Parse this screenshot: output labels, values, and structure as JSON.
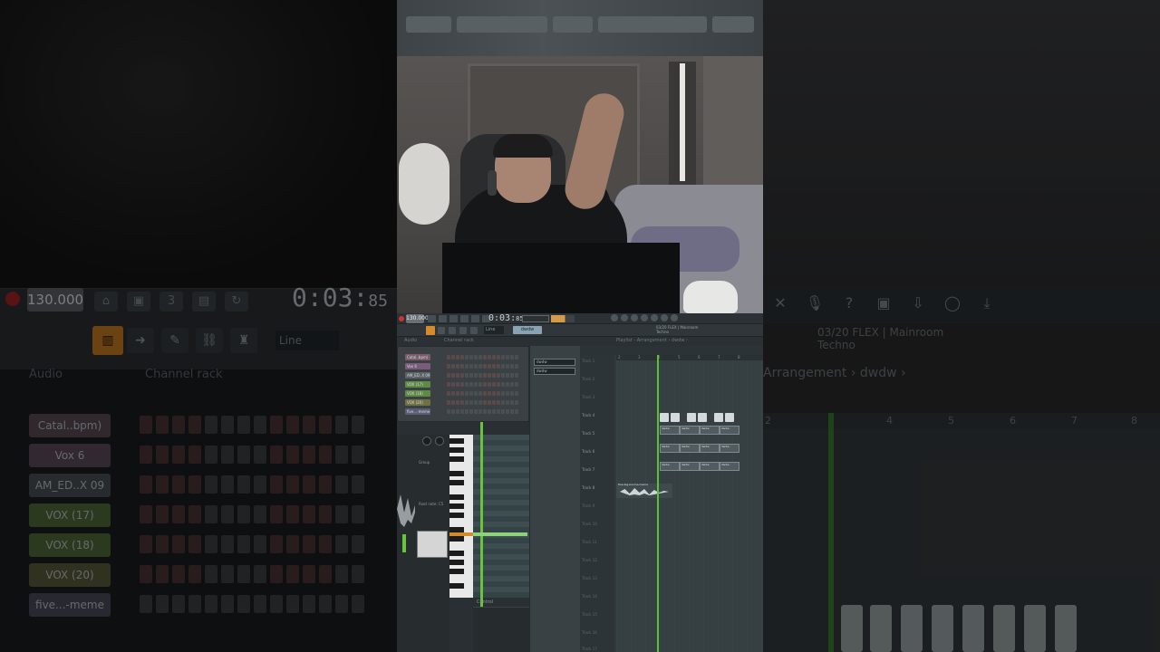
{
  "left_bg": {
    "bpm": "130.000",
    "time_main": "0:03",
    "time_frac": "85",
    "menu_audio": "Audio",
    "menu_channel_rack": "Channel rack",
    "snap": "Line",
    "channels": [
      {
        "name": "Catal..bpm)",
        "color": "#5a4a52"
      },
      {
        "name": "Vox 6",
        "color": "#5a4a5a"
      },
      {
        "name": "AM_ED..X 09",
        "color": "#4a4f52"
      },
      {
        "name": "VOX (17)",
        "color": "#4f6a3a"
      },
      {
        "name": "VOX (18)",
        "color": "#4f6a3a"
      },
      {
        "name": "VOX (20)",
        "color": "#5a5a3a"
      },
      {
        "name": "five...-meme",
        "color": "#4a4a5a"
      }
    ]
  },
  "right_bg": {
    "news_line1": "03/20  FLEX | Mainroom",
    "news_line2": "Techno",
    "breadcrumb": "Arrangement › dwdw ›",
    "ruler": [
      "2",
      "4",
      "5",
      "6",
      "7",
      "8"
    ]
  },
  "fl": {
    "bpm": "130.000",
    "time_main": "0:03",
    "time_frac": "85",
    "snap": "Line",
    "pattern": "dwdw",
    "news": [
      "03/20 FLEX | Mainroom",
      "Techno"
    ],
    "row2": {
      "audio": "Audio",
      "channel_rack": "Channel rack",
      "playlist": "Playlist - Arrangement › dwdw ›"
    },
    "channels": [
      {
        "name": "Catal..bpm)",
        "color": "#7a5c6a"
      },
      {
        "name": "Vox 6",
        "color": "#7a5c7a"
      },
      {
        "name": "AM_ED..X 09",
        "color": "#5c6266"
      },
      {
        "name": "VOX (17)",
        "color": "#5e8a44"
      },
      {
        "name": "VOX (18)",
        "color": "#5e8a44"
      },
      {
        "name": "VOX (20)",
        "color": "#707044"
      },
      {
        "name": "five...-meme",
        "color": "#5c5c74"
      }
    ],
    "piano_labels": {
      "group": "Group",
      "root_note": "Root note: C5",
      "controls": "Control"
    },
    "patterns": [
      "dwdw",
      "dwdw"
    ],
    "tracks": [
      "Track 1",
      "Track 2",
      "Track 3",
      "Track 4",
      "Track 5",
      "Track 6",
      "Track 7",
      "Track 8",
      "Track 9",
      "Track 10",
      "Track 11",
      "Track 12",
      "Track 13",
      "Track 14",
      "Track 15",
      "Track 16",
      "Track 17"
    ],
    "clip_label": "dwdw",
    "audio_clip_label": "five-big-booms-meme",
    "ruler": [
      "2",
      "3",
      "4",
      "5",
      "6",
      "7",
      "8"
    ]
  }
}
